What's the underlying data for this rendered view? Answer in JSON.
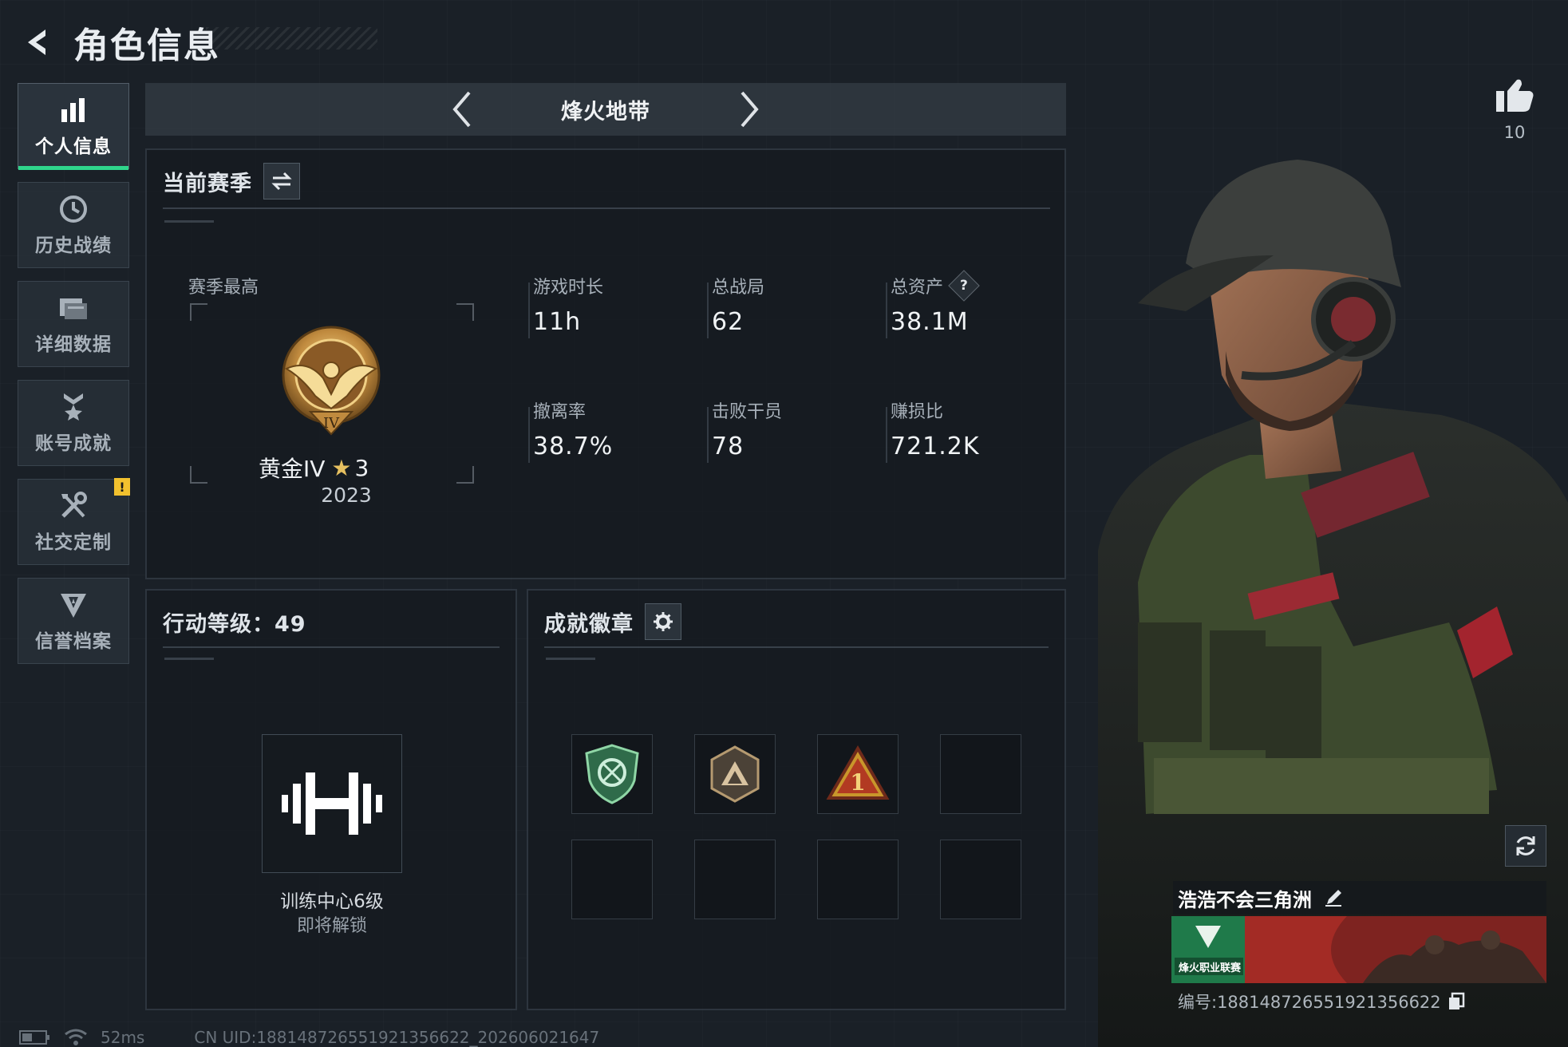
{
  "header": {
    "title": "角色信息"
  },
  "sidebar": {
    "items": [
      {
        "label": "个人信息",
        "icon": "bar-chart-icon",
        "active": true
      },
      {
        "label": "历史战绩",
        "icon": "clock-icon"
      },
      {
        "label": "详细数据",
        "icon": "folder-icon"
      },
      {
        "label": "账号成就",
        "icon": "medal-icon"
      },
      {
        "label": "社交定制",
        "icon": "wrench-icon",
        "badge": "!"
      },
      {
        "label": "信誉档案",
        "icon": "shield-icon"
      }
    ]
  },
  "mode": {
    "name": "烽火地带"
  },
  "season": {
    "title": "当前赛季",
    "highest_label": "赛季最高",
    "rank_name": "黄金IV",
    "rank_stars": "3",
    "rank_year": "2023",
    "stats": [
      {
        "label": "游戏时长",
        "value": "11h"
      },
      {
        "label": "总战局",
        "value": "62"
      },
      {
        "label": "总资产",
        "value": "38.1M",
        "help": "?"
      },
      {
        "label": "撤离率",
        "value": "38.7%"
      },
      {
        "label": "击败干员",
        "value": "78"
      },
      {
        "label": "赚损比",
        "value": "721.2K"
      }
    ]
  },
  "action_level": {
    "title": "行动等级：49",
    "unlock_title": "训练中心6级",
    "unlock_status": "即将解锁"
  },
  "badges": {
    "title": "成就徽章",
    "slots": [
      "green-shield-badge",
      "bronze-hex-badge",
      "gold-triangle-badge",
      "empty",
      "empty",
      "empty",
      "empty",
      "empty"
    ]
  },
  "player": {
    "likes": "10",
    "name": "浩浩不会三角洲",
    "id_text": "编号:18814872655192135662​2",
    "banner_text": "烽火职业联赛"
  },
  "status_bar": {
    "latency": "52ms",
    "uid": "CN UID:18814872655192135662​2_202606021647"
  },
  "colors": {
    "accent": "#2fd58b",
    "warning": "#f2c12e",
    "background": "#1a2027"
  }
}
